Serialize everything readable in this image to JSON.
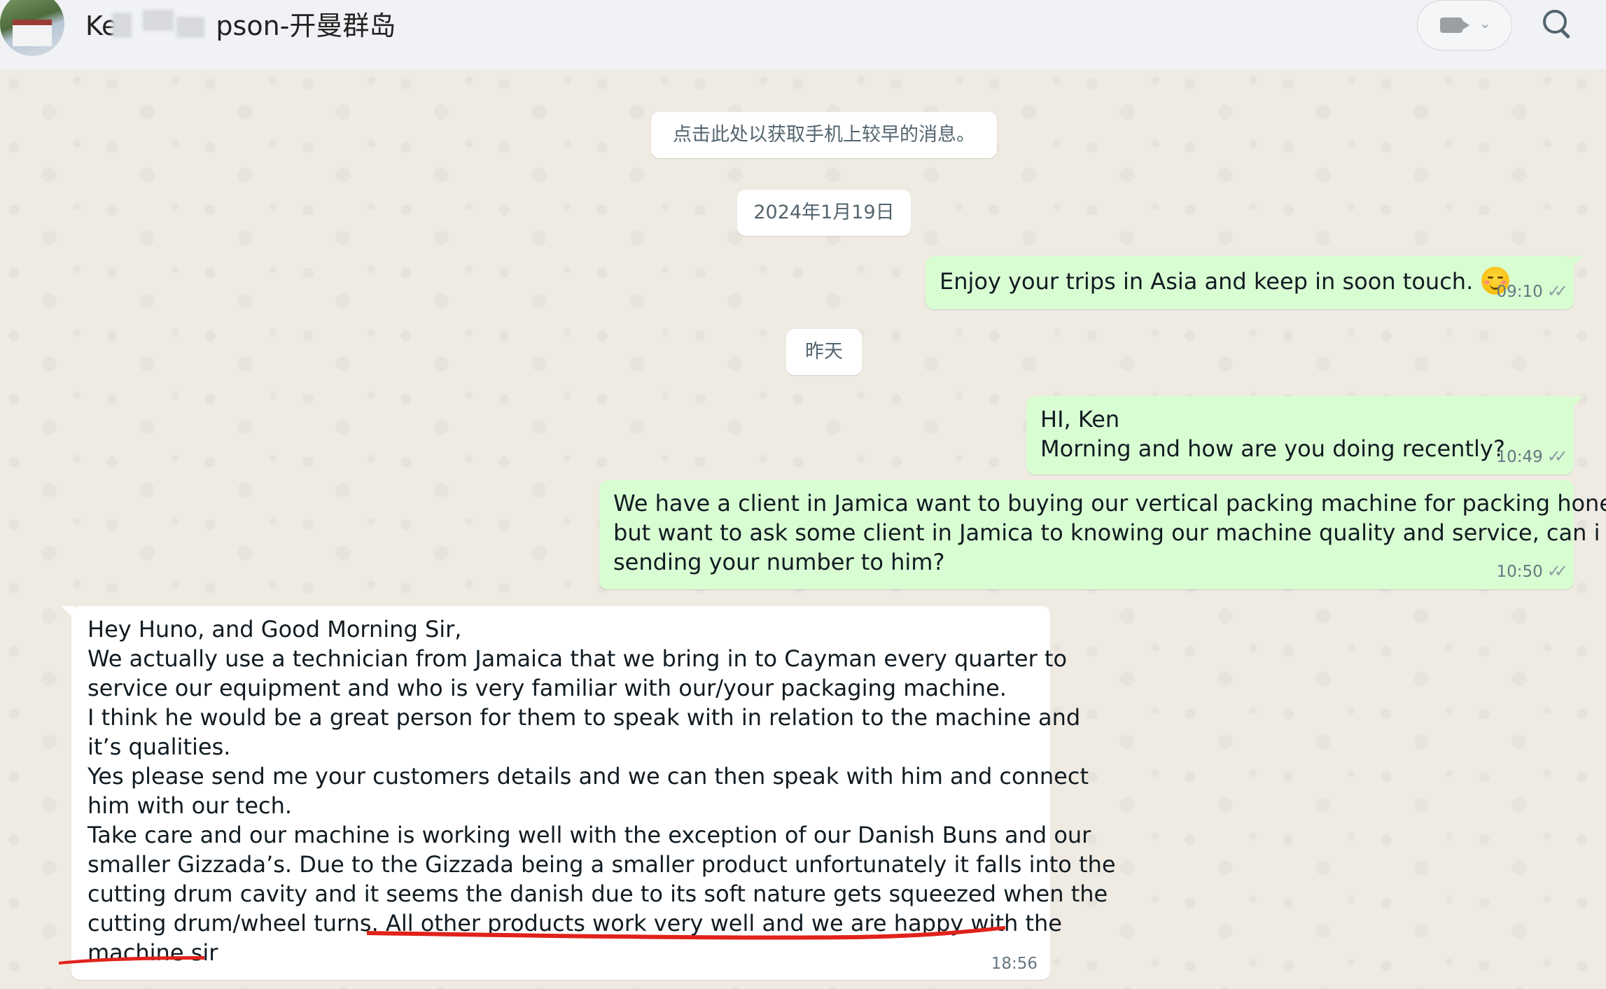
{
  "header": {
    "contact_name_start": "Ke",
    "contact_name_end": "pson-开曼群岛",
    "video_chevron": "⌄"
  },
  "chat": {
    "load_earlier": "点击此处以获取手机上较早的消息。",
    "date_1": "2024年1月19日",
    "date_2": "昨天",
    "messages": [
      {
        "direction": "outgoing",
        "lines": [
          "Enjoy your trips in Asia and keep in soon touch."
        ],
        "emoji": "relieved-face",
        "time": "09:10",
        "status": "read"
      },
      {
        "direction": "outgoing",
        "lines": [
          "HI, Ken",
          "Morning and how are you doing recently?"
        ],
        "time": "10:49",
        "status": "read"
      },
      {
        "direction": "outgoing",
        "lines": [
          "We have a client in Jamica want to buying our vertical packing machine for packing honey,",
          "but want to ask some client in Jamica to knowing our machine quality and service, can i",
          "sending your number to him?"
        ],
        "time": "10:50",
        "status": "read"
      },
      {
        "direction": "incoming",
        "lines": [
          "Hey Huno, and Good Morning Sir,",
          "We actually use a technician from Jamaica that we bring in to Cayman every quarter to",
          "service our equipment and who is very familiar with our/your packaging machine.",
          "I think he would be a great person for them to speak with in relation to the machine and",
          "it’s qualities.",
          "Yes please send me your customers details and we can then speak with him and connect",
          "him with our tech.",
          "Take care and our machine is working well with the exception of our Danish Buns and our",
          "smaller Gizzada’s. Due to the Gizzada being a smaller product unfortunately it falls into the",
          "cutting drum cavity and it seems the danish due to its soft nature gets squeezed when the",
          "cutting drum/wheel turns. All other products work very well and we are happy with the",
          "machine sir"
        ],
        "time": "18:56"
      }
    ],
    "ticks": "✓✓",
    "colors": {
      "outgoing_bubble": "#d9fdd3",
      "incoming_bubble": "#ffffff",
      "annotation": "#e0221b"
    }
  }
}
